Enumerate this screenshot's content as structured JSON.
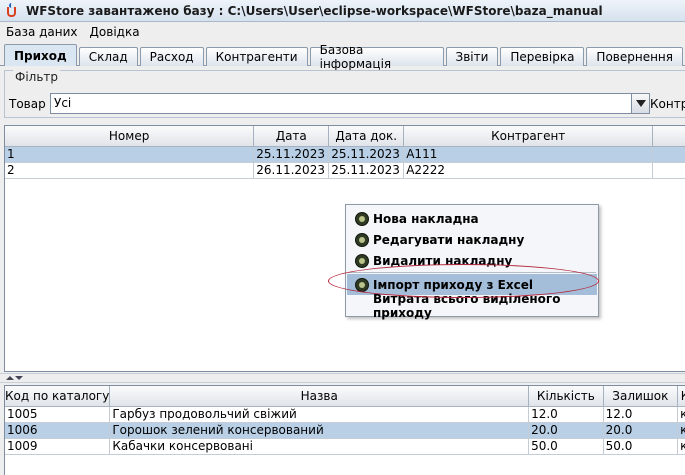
{
  "window": {
    "title": "WFStore завантажено базу : C:\\Users\\User\\eclipse-workspace\\WFStore\\baza_manual"
  },
  "menu": [
    "База даних",
    "Довідка"
  ],
  "tabs": [
    "Приход",
    "Склад",
    "Расход",
    "Контрагенти",
    "Базова інформація",
    "Звіти",
    "Перевірка",
    "Повернення"
  ],
  "active_tab": "Приход",
  "filter": {
    "title": "Фільтр",
    "product_label": "Товар :",
    "product_value": "Усі",
    "counterparty_label": "Контра"
  },
  "invoices": {
    "columns": [
      "Номер",
      "Дата",
      "Дата док.",
      "Контрагент"
    ],
    "rows": [
      {
        "number": "1",
        "date": "25.11.2023",
        "doc_date": "25.11.2023",
        "counterparty": "A111",
        "selected": true
      },
      {
        "number": "2",
        "date": "26.11.2023",
        "doc_date": "25.11.2023",
        "counterparty": "A2222",
        "selected": false
      }
    ]
  },
  "context_menu": {
    "items": [
      {
        "label": "Нова накладна",
        "icon": "new-invoice-icon"
      },
      {
        "label": "Редагувати накладну",
        "icon": "edit-invoice-icon"
      },
      {
        "label": "Видалити накладну",
        "icon": "delete-invoice-icon"
      },
      {
        "label": "Імпорт приходу з Excel",
        "icon": "import-excel-icon",
        "highlighted": true
      },
      {
        "label": "Витрата всього виділеного приходу",
        "icon": ""
      }
    ]
  },
  "items": {
    "columns": [
      "Код по каталогу",
      "Назва",
      "Кількість",
      "Залишок",
      "К"
    ],
    "rows": [
      {
        "code": "1005",
        "name": "Гарбуз продовольчий свіжий",
        "qty": "12.0",
        "rest": "12.0",
        "extra": "к",
        "selected": false
      },
      {
        "code": "1006",
        "name": "Горошок зелений консервований",
        "qty": "20.0",
        "rest": "20.0",
        "extra": "к",
        "selected": true
      },
      {
        "code": "1009",
        "name": "Кабачки консервовані",
        "qty": "50.0",
        "rest": "50.0",
        "extra": "к",
        "selected": false
      }
    ]
  },
  "colors": {
    "selection": "#b8cfe5",
    "menu_highlight": "#a4bed9",
    "annotation": "#b3253a"
  }
}
